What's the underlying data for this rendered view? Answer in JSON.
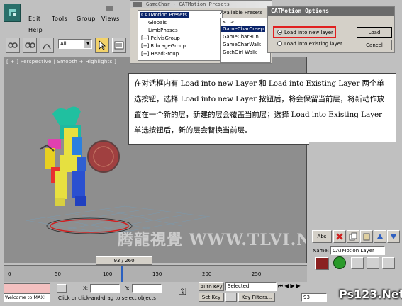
{
  "menu": {
    "items": [
      "Edit",
      "Tools",
      "Group",
      "Views"
    ],
    "row2": [
      "Help"
    ]
  },
  "toolbar": {
    "selection_filter": "All"
  },
  "viewport": {
    "label": "[ + ] Perspective | Smooth + Highlights ]"
  },
  "cat_window": {
    "title": "GameChar - CATMotion Presets",
    "tree_root": "CATMotion Presets",
    "tree_items": [
      "Globals",
      "LimbPhases",
      "[+] PelvisGroup",
      "[+] RibcageGroup",
      "[+] HeadGroup"
    ],
    "available_label": "Available Presets",
    "available_items": [
      "<..>",
      "GameCharCreep",
      "GameCharRun",
      "GameCharWalk",
      "GothGirl Walk"
    ]
  },
  "options_dialog": {
    "title": "CATMotion Options",
    "radio_new": "Load into new layer",
    "radio_existing": "Load into existing layer",
    "load_button": "Load",
    "cancel_button": "Cancel"
  },
  "callout": {
    "text": "在对话框内有 Load into new Layer 和 Load into Existing Layer 两个单选按钮，选择 Load into new Layer 按钮后，将会保留当前层，将新动作放置在一个新的层，新建的层会覆盖当前层；选择 Load into Existing Layer 单选按钮后，新的层会替换当前层。"
  },
  "command_panel": {
    "name_label": "Name:",
    "name_value": "CATMotion Layer",
    "abs_label": "Abs"
  },
  "timeline": {
    "frame_display": "93 / 260",
    "ticks": [
      "0",
      "50",
      "100",
      "150",
      "200",
      "250"
    ]
  },
  "status": {
    "welcome": "Welcome to MAX!",
    "hint": "Click or click-and-drag to select objects",
    "x_label": "X:",
    "y_label": "Y:",
    "auto_key": "Auto Key",
    "set_key": "Set Key",
    "selected": "Selected",
    "key_filters": "Key Filters...",
    "frame": "93"
  },
  "watermarks": {
    "center": "腾龍視覺 WWW.TLVI.NET",
    "corner": "Ps123.Net"
  },
  "colors": {
    "selection": "#0a246a",
    "highlight_box": "#e02020"
  }
}
